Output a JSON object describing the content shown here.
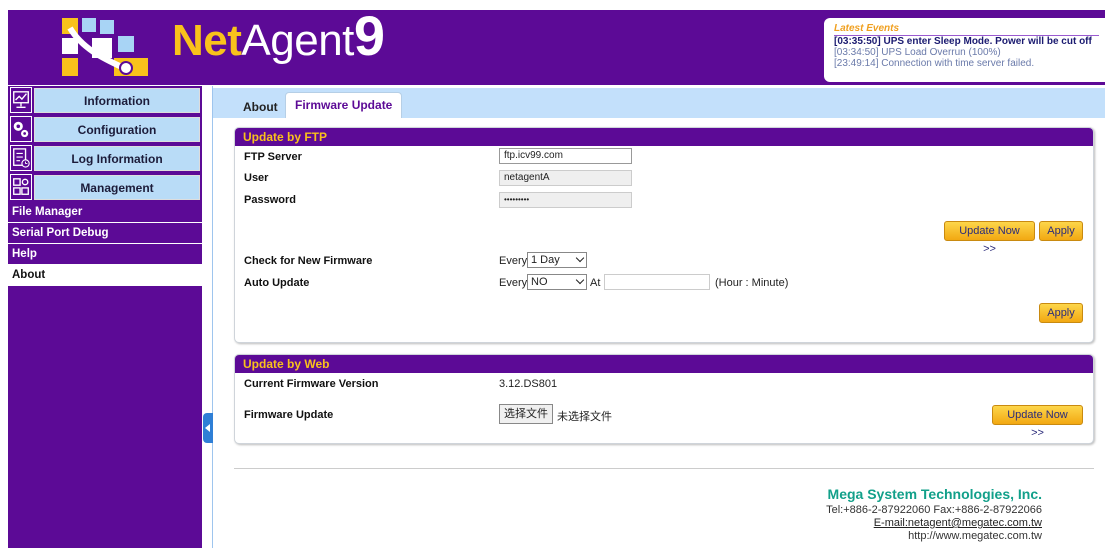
{
  "header": {
    "brand_part1": "Net",
    "brand_part2": "Agent",
    "brand_part3": "9",
    "events_title": "Latest Events",
    "events": [
      "[03:35:50] UPS enter Sleep Mode. Power will be cut off",
      "[03:34:50] UPS Load Overrun (100%)",
      "[23:49:14] Connection with time server failed."
    ]
  },
  "sidebar": {
    "menu": [
      {
        "label": "Information",
        "icon": "monitor-chart-icon"
      },
      {
        "label": "Configuration",
        "icon": "gears-icon"
      },
      {
        "label": "Log Information",
        "icon": "log-clock-icon"
      },
      {
        "label": "Management",
        "icon": "grid-gear-icon"
      }
    ],
    "subitems": [
      "File Manager",
      "Serial Port Debug",
      "Help",
      "About"
    ],
    "active_subitem": "About"
  },
  "tabs": {
    "about": "About",
    "firmware": "Firmware Update",
    "active": "Firmware Update"
  },
  "ftp": {
    "title": "Update by FTP",
    "server_label": "FTP Server",
    "server_value": "ftp.icv99.com",
    "user_label": "User",
    "user_value": "netagentA",
    "password_label": "Password",
    "password_value": "•••••••••",
    "update_now": "Update Now >>",
    "apply": "Apply",
    "check_label": "Check for New Firmware",
    "every1": "Every",
    "check_value": "1 Day",
    "auto_label": "Auto Update",
    "every2": "Every",
    "auto_value": "NO",
    "at": "At",
    "time_value": "",
    "hour_minute": "(Hour : Minute)",
    "apply2": "Apply"
  },
  "web": {
    "title": "Update by Web",
    "current_label": "Current Firmware Version",
    "current_value": "3.12.DS801",
    "fw_label": "Firmware Update",
    "choose_file": "选择文件",
    "no_file": "未选择文件",
    "update_now": "Update Now >>"
  },
  "footer": {
    "company": "Mega System Technologies, Inc.",
    "tel": "Tel:+886-2-87922060 Fax:+886-2-87922066",
    "email": "E-mail:netagent@megatec.com.tw",
    "web": "http://www.megatec.com.tw"
  },
  "colors": {
    "brand_purple": "#5c0a96",
    "brand_yellow": "#f9c21b",
    "tab_bar": "#c3e0fb",
    "menu_button": "#b9dcf7"
  }
}
